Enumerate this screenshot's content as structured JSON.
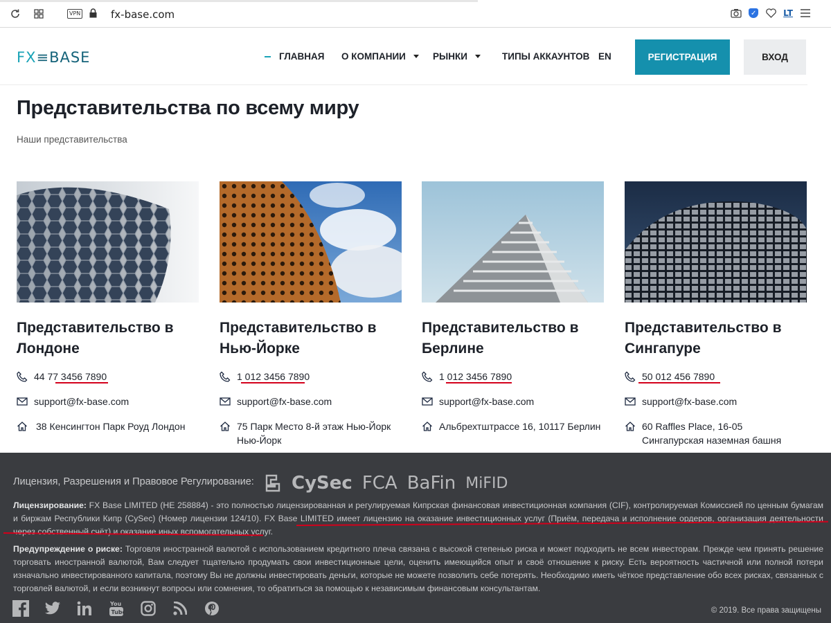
{
  "browser": {
    "url": "fx-base.com",
    "vpn_label": "VPN",
    "ext_lt": "LT"
  },
  "header": {
    "logo_left": "FX",
    "logo_right": "BASE",
    "nav": [
      {
        "label": "ГЛАВНАЯ"
      },
      {
        "label": "О КОМПАНИИ"
      },
      {
        "label": "РЫНКИ"
      },
      {
        "label": "ТИПЫ АККАУНТОВ"
      },
      {
        "label": "EN"
      }
    ],
    "register_label": "РЕГИСТРАЦИЯ",
    "login_label": "ВХОД"
  },
  "main": {
    "title": "Представительства по всему миру",
    "subtitle": "Наши представительства",
    "offices": [
      {
        "title": "Представительство в Лондоне",
        "phone": "44 77 3456 7890",
        "email": "support@fx-base.com",
        "address": "38 Кенсингтон Парк Роуд Лондон"
      },
      {
        "title": "Представительство в Нью-Йорке",
        "phone": "1 012 3456 7890",
        "email": "support@fx-base.com",
        "address": "75 Парк Место 8-й этаж Нью-Йорк Нью-Йорк"
      },
      {
        "title": "Представительство в Берлине",
        "phone": "1 012 3456 7890",
        "email": "support@fx-base.com",
        "address": "Альбрехтштрассе 16, 10117 Берлин"
      },
      {
        "title": "Представительство в Сингапуре",
        "phone": "50 012 456 7890",
        "email": "support@fx-base.com",
        "address": "60 Raffles Place, 16-05 Сингапурская наземная башня"
      }
    ]
  },
  "footer": {
    "regulation_label": "Лицензия, Разрешения и Правовое Регулирование:",
    "regulators": [
      "CySec",
      "FCA",
      "BaFin",
      "MiFID"
    ],
    "licensing_label": "Лицензирование:",
    "licensing_text": " FX Base LIMITED (HE 258884) - это полностью лицензированная и регулируемая Кипрская финансовая инвестиционная компания (CIF), контролируемая Комиссией по ценным бумагам и биржам Республики Кипр (CySec) (Номер лицензии 124/10). FX Base LIMITED имеет лицензию на оказание инвестиционных услуг (Приём, передача и исполнение ордеров, организация деятельности через собственный счёт) и оказание иных вспомогательных услуг.",
    "risk_label": "Предупреждение о риске:",
    "risk_text": " Торговля иностранной валютой с использованием кредитного плеча связана с высокой степенью риска и может подходить не всем инвесторам. Прежде чем принять решение торговать иностранной валютой, Вам следует тщательно продумать свои инвестиционные цели, оценить имеющийся опыт и своё отношение к риску. Есть вероятность частичной или полной потери изначально инвестированного капитала, поэтому Вы не должны инвестировать деньги, которые не можете позволить себе потерять. Необходимо иметь чёткое представление обо всех рисках, связанных с торговлей валютой, и если возникнут вопросы или сомнения, то обратиться за помощью к независимым финансовым консультантам.",
    "copyright": "© 2019. Все права защищены",
    "social_icons": [
      "facebook-icon",
      "twitter-icon",
      "linkedin-icon",
      "youtube-icon",
      "instagram-icon",
      "rss-icon",
      "pinterest-icon"
    ]
  },
  "colors": {
    "accent": "#1590ad",
    "annotation_red": "#d3001b",
    "footer_bg": "#3a3c40"
  }
}
